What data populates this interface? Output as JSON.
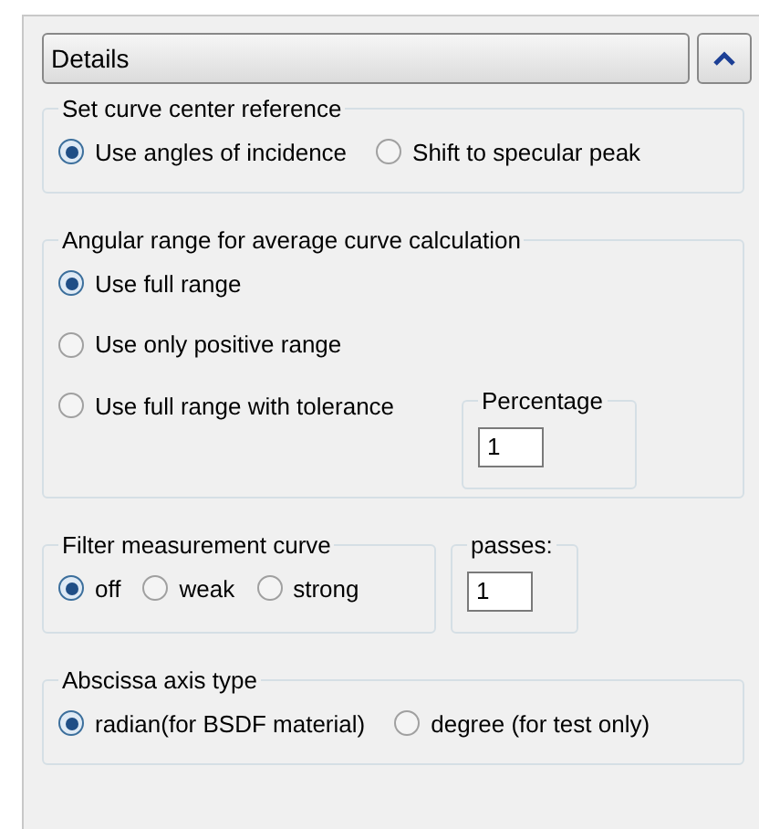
{
  "header": {
    "title": "Details",
    "expanded": true
  },
  "center_reference": {
    "title": "Set curve center reference",
    "options": [
      {
        "label": "Use angles of incidence",
        "selected": true
      },
      {
        "label": "Shift to specular peak",
        "selected": false
      }
    ]
  },
  "angular_range": {
    "title": "Angular range for average curve calculation",
    "options": [
      {
        "label": "Use full range",
        "selected": true
      },
      {
        "label": "Use only positive range",
        "selected": false
      },
      {
        "label": "Use full range with tolerance",
        "selected": false
      }
    ],
    "tolerance": {
      "title": "Percentage",
      "value": "1"
    }
  },
  "filter": {
    "title": "Filter measurement curve",
    "options": [
      {
        "label": "off",
        "selected": true
      },
      {
        "label": "weak",
        "selected": false
      },
      {
        "label": "strong",
        "selected": false
      }
    ],
    "passes": {
      "title": "passes:",
      "value": "1"
    }
  },
  "abscissa": {
    "title": "Abscissa axis type",
    "options": [
      {
        "label": "radian(for BSDF material)",
        "selected": true
      },
      {
        "label": "degree (for test only)",
        "selected": false
      }
    ]
  }
}
